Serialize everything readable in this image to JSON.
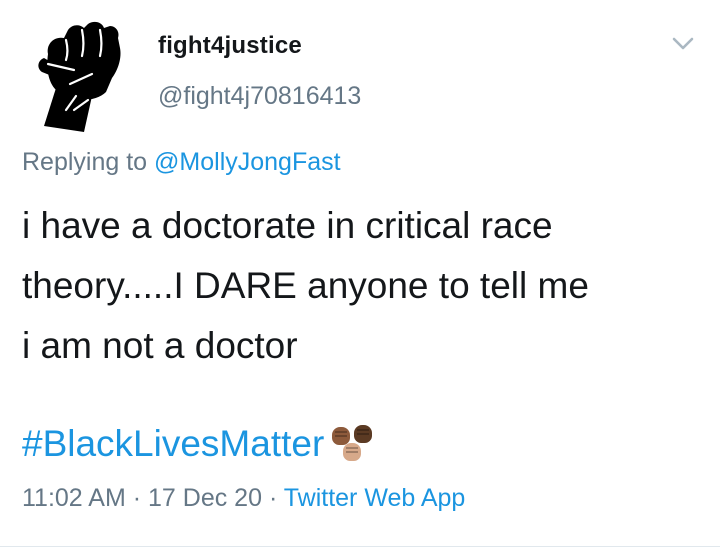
{
  "tweet": {
    "display_name": "fight4justice",
    "handle": "@fight4j70816413",
    "avatar_icon": "raised-fist-icon",
    "menu_icon": "chevron-down-icon",
    "reply_prefix": "Replying to",
    "reply_to": "@MollyJongFast",
    "body_lines": [
      "i have a doctorate in critical race",
      "theory.....I DARE anyone to tell me",
      "i am not a doctor"
    ],
    "hashtag": "#BlackLivesMatter",
    "emoji_icon": "raised-fists-emoji",
    "time": "11:02 AM",
    "separator": "·",
    "date": "17 Dec 20",
    "source": "Twitter Web App"
  },
  "colors": {
    "text": "#14171a",
    "muted": "#657786",
    "link": "#1b95e0",
    "divider": "#e1e8ed"
  }
}
